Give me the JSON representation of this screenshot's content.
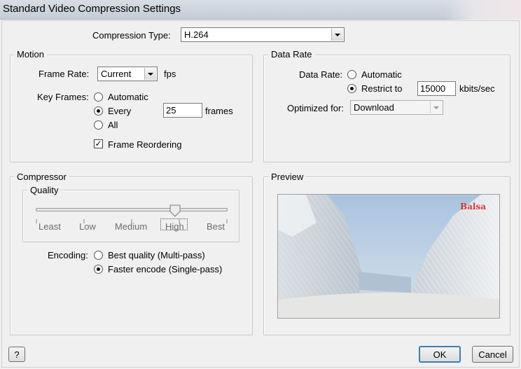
{
  "window": {
    "title": "Standard Video Compression Settings"
  },
  "compression_type": {
    "label": "Compression Type:",
    "value": "H.264"
  },
  "motion": {
    "legend": "Motion",
    "frame_rate": {
      "label": "Frame Rate:",
      "value": "Current",
      "unit": "fps"
    },
    "key_frames": {
      "label": "Key Frames:",
      "options": [
        "Automatic",
        "Every",
        "All"
      ],
      "selected": "Every",
      "every_value": "25",
      "every_unit": "frames"
    },
    "frame_reordering": {
      "label": "Frame Reordering",
      "checked": true
    }
  },
  "data_rate": {
    "legend": "Data Rate",
    "label": "Data Rate:",
    "options": [
      "Automatic",
      "Restrict to"
    ],
    "selected": "Restrict to",
    "restrict_value": "15000",
    "unit": "kbits/sec",
    "optimized_for": {
      "label": "Optimized for:",
      "value": "Download"
    }
  },
  "compressor": {
    "legend": "Compressor",
    "quality": {
      "legend": "Quality",
      "ticks": [
        "Least",
        "Low",
        "Medium",
        "High",
        "Best"
      ],
      "selected": "High"
    },
    "encoding": {
      "label": "Encoding:",
      "options": [
        "Best quality (Multi-pass)",
        "Faster encode (Single-pass)"
      ],
      "selected": "Faster encode (Single-pass)"
    }
  },
  "preview": {
    "legend": "Preview",
    "watermark": "Balsa"
  },
  "buttons": {
    "help": "?",
    "ok": "OK",
    "cancel": "Cancel"
  }
}
